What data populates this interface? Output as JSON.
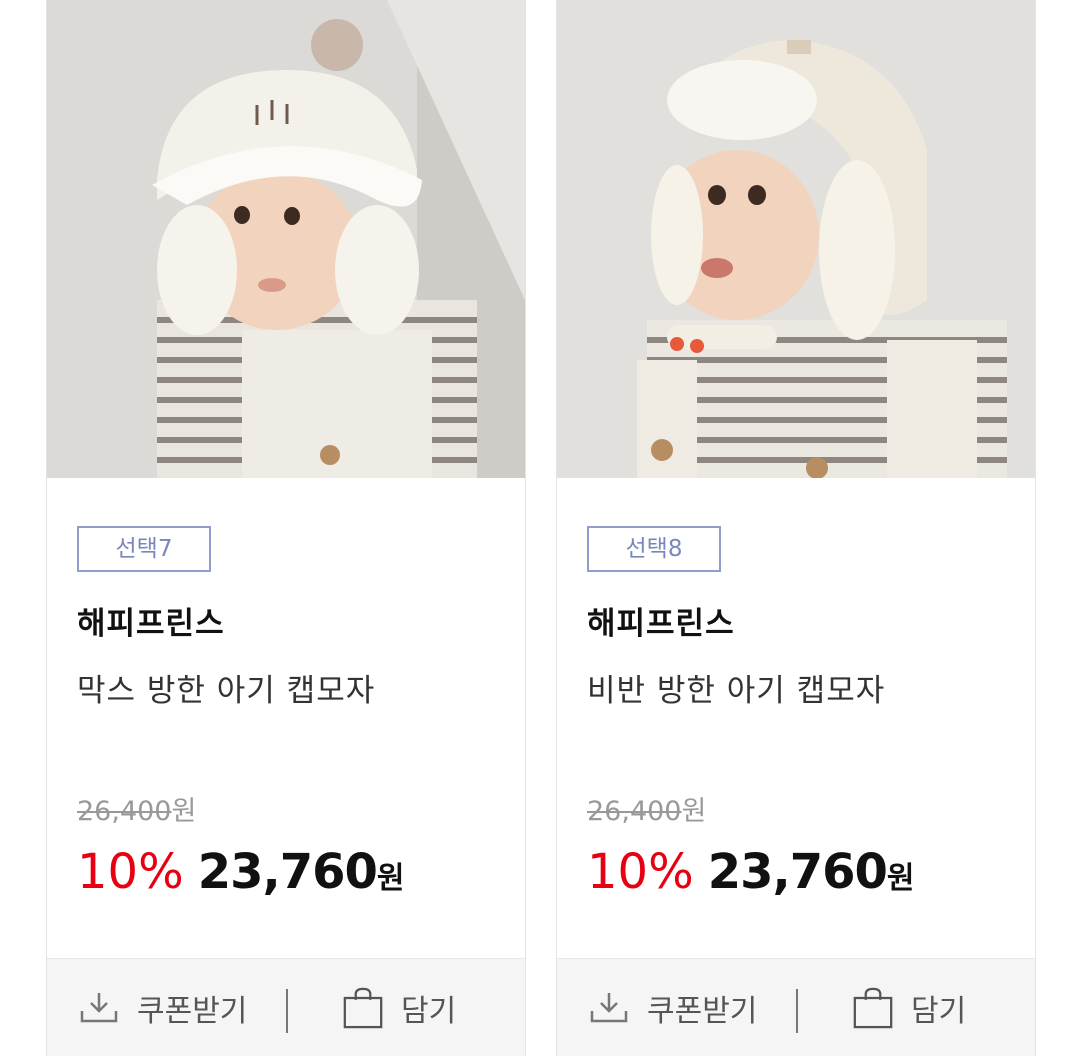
{
  "products": [
    {
      "option_badge": "선택7",
      "brand": "해피프린스",
      "name": "막스 방한 아기 캡모자",
      "original_price": "26,400",
      "original_currency": "원",
      "discount_rate": "10%",
      "sale_price": "23,760",
      "sale_currency": "원",
      "coupon_label": "쿠폰받기",
      "cart_label": "담기",
      "image_alt": "baby wearing white corduroy pom-pom earflap hat"
    },
    {
      "option_badge": "선택8",
      "brand": "해피프린스",
      "name": "비반 방한 아기 캡모자",
      "original_price": "26,400",
      "original_currency": "원",
      "discount_rate": "10%",
      "sale_price": "23,760",
      "sale_currency": "원",
      "coupon_label": "쿠폰받기",
      "cart_label": "담기",
      "image_alt": "baby wearing cream trapper hat with fleece lining"
    }
  ],
  "colors": {
    "discount": "#e60012",
    "badge_border": "#8f9ccc",
    "action_bar": "#f5f5f5"
  },
  "icons": {
    "coupon": "download-icon",
    "cart": "shopping-bag-icon"
  }
}
